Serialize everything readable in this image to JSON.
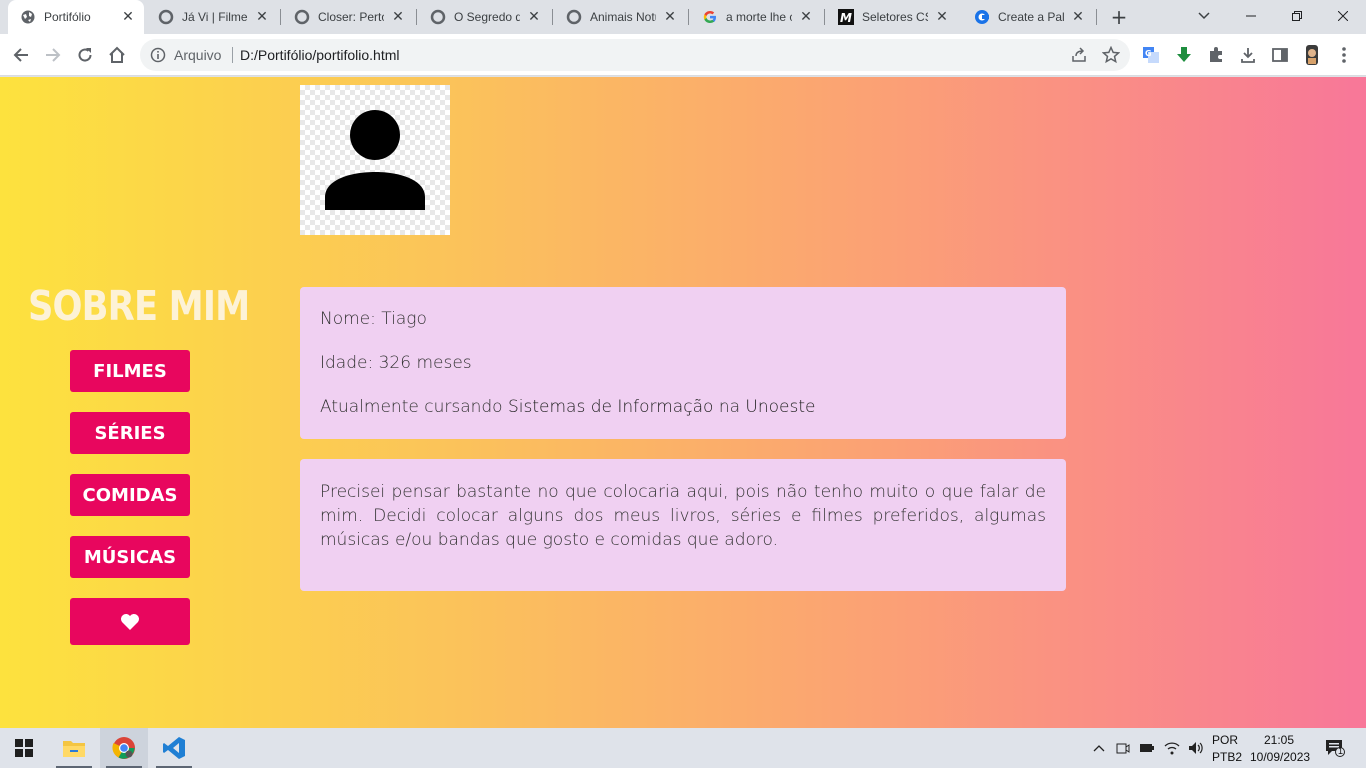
{
  "browser": {
    "tabs": [
      {
        "title": "Portifólio",
        "icon": "globe-icon",
        "active": true
      },
      {
        "title": "Já Vi | Filmes",
        "icon": "chrome-circle-icon"
      },
      {
        "title": "Closer: Perto",
        "icon": "chrome-circle-icon"
      },
      {
        "title": "O Segredo do",
        "icon": "chrome-circle-icon"
      },
      {
        "title": "Animais Notu",
        "icon": "chrome-circle-icon"
      },
      {
        "title": "a morte lhe ca",
        "icon": "google-g-icon"
      },
      {
        "title": "Seletores CSS",
        "icon": "m-logo-icon"
      },
      {
        "title": "Create a Palet",
        "icon": "c-logo-icon"
      }
    ],
    "new_tab": "+",
    "address": {
      "scheme": "Arquivo",
      "url": "D:/Portifólio/portifolio.html"
    }
  },
  "page": {
    "sidebar_title": "SOBRE MIM",
    "nav": [
      {
        "label": "FILMES"
      },
      {
        "label": "SÉRIES"
      },
      {
        "label": "COMIDAS"
      },
      {
        "label": "MÚSICAS"
      },
      {
        "label": "♥",
        "icon": "heart-icon"
      }
    ],
    "info": {
      "name": "Nome: Tiago",
      "age": "Idade: 326 meses",
      "course_prefix": "Atualmente cursando",
      "course": "Sistemas de Informação",
      "course_mid": "na",
      "university": "Unoeste"
    },
    "about": "Precisei pensar bastante no que colocaria aqui, pois não tenho muito o que falar de mim. Decidi colocar alguns dos meus livros, séries e filmes preferidos, algumas músicas e/ou bandas que gosto e comidas que adoro."
  },
  "taskbar": {
    "lang_top": "POR",
    "lang_bottom": "PTB2",
    "time": "21:05",
    "date": "10/09/2023",
    "notification_count": "1"
  },
  "colors": {
    "accent": "#e8065e",
    "card": "#f0d0f2",
    "gradient_start": "#fde23e",
    "gradient_end": "#f87799"
  }
}
